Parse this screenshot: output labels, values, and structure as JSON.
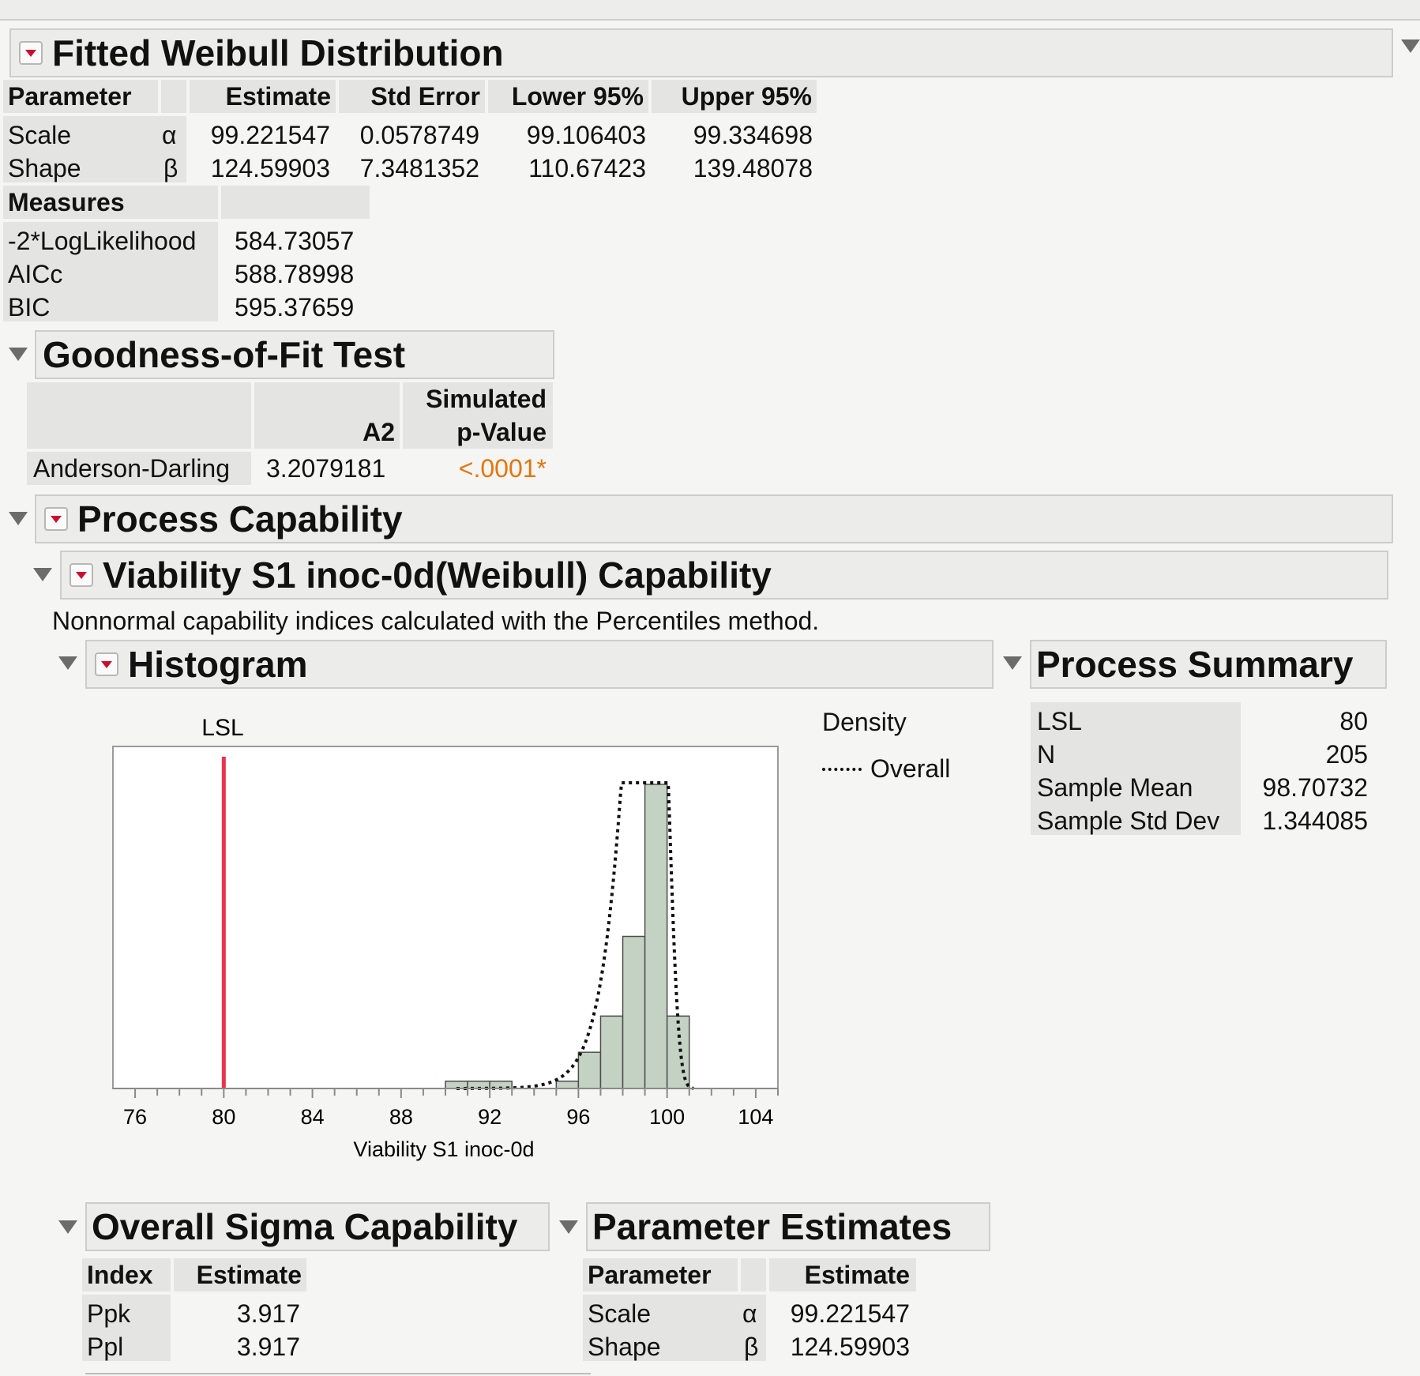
{
  "fitted": {
    "title": "Fitted Weibull Distribution",
    "table": {
      "headers": [
        "Parameter",
        "",
        "Estimate",
        "Std Error",
        "Lower 95%",
        "Upper 95%"
      ],
      "rows": [
        {
          "name": "Scale",
          "sym": "α",
          "estimate": "99.221547",
          "stderr": "0.0578749",
          "lower": "99.106403",
          "upper": "99.334698"
        },
        {
          "name": "Shape",
          "sym": "β",
          "estimate": "124.59903",
          "stderr": "7.3481352",
          "lower": "110.67423",
          "upper": "139.48078"
        }
      ]
    },
    "measures": {
      "header": "Measures",
      "rows": [
        {
          "name": "-2*LogLikelihood",
          "value": "584.73057"
        },
        {
          "name": "AICc",
          "value": "588.78998"
        },
        {
          "name": "BIC",
          "value": "595.37659"
        }
      ]
    }
  },
  "gof": {
    "title": "Goodness-of-Fit Test",
    "col_a2": "A2",
    "col_sim_1": "Simulated",
    "col_sim_2": "p-Value",
    "row": {
      "name": "Anderson-Darling",
      "a2": "3.2079181",
      "p": "<.0001*"
    },
    "p_color": "#e2760f"
  },
  "capability": {
    "title": "Process Capability",
    "sub_title": "Viability S1 inoc-0d(Weibull) Capability",
    "note": "Nonnormal capability indices calculated with the Percentiles method."
  },
  "histogram": {
    "title": "Histogram",
    "lsl_label": "LSL",
    "legend_title": "Density",
    "legend_item": "Overall"
  },
  "summary": {
    "title": "Process Summary",
    "rows": [
      {
        "name": "LSL",
        "value": "80"
      },
      {
        "name": "N",
        "value": "205"
      },
      {
        "name": "Sample Mean",
        "value": "98.70732"
      },
      {
        "name": "Sample Std Dev",
        "value": "1.344085"
      }
    ]
  },
  "overall": {
    "title": "Overall Sigma Capability",
    "headers": [
      "Index",
      "Estimate"
    ],
    "rows": [
      {
        "name": "Ppk",
        "value": "3.917"
      },
      {
        "name": "Ppl",
        "value": "3.917"
      }
    ]
  },
  "params": {
    "title": "Parameter Estimates",
    "headers": [
      "Parameter",
      "",
      "Estimate"
    ],
    "rows": [
      {
        "name": "Scale",
        "sym": "α",
        "value": "99.221547"
      },
      {
        "name": "Shape",
        "sym": "β",
        "value": "124.59903"
      }
    ]
  },
  "chart_data": {
    "type": "bar",
    "xlabel": "Viability S1 inoc-0d",
    "xlim": [
      75,
      105
    ],
    "xticks": [
      76,
      80,
      84,
      88,
      92,
      96,
      100,
      104
    ],
    "bin_width": 1,
    "bins": [
      {
        "x0": 90,
        "count": 1
      },
      {
        "x0": 91,
        "count": 1
      },
      {
        "x0": 92,
        "count": 1
      },
      {
        "x0": 95,
        "count": 1
      },
      {
        "x0": 96,
        "count": 5
      },
      {
        "x0": 97,
        "count": 10
      },
      {
        "x0": 98,
        "count": 21
      },
      {
        "x0": 99,
        "count": 42
      },
      {
        "x0": 100,
        "count": 10
      }
    ],
    "lsl": 80,
    "lsl_color": "#e8344e",
    "bar_color": "#c3d2c3",
    "density": {
      "name": "Overall",
      "dist": "weibull",
      "scale": 99.221547,
      "shape": 124.59903,
      "n": 205
    }
  }
}
